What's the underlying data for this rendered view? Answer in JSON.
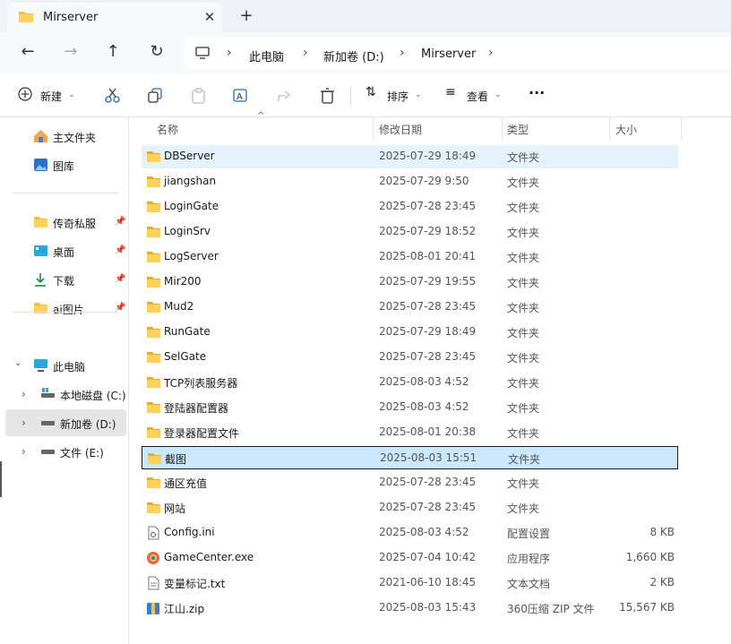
{
  "tab": {
    "title": "Mirserver",
    "close": "✕",
    "new": "+"
  },
  "nav": {
    "back": "←",
    "forward": "→",
    "up": "↑",
    "refresh": "↻"
  },
  "breadcrumb": [
    "此电脑",
    "新加卷 (D:)",
    "Mirserver"
  ],
  "toolbar": {
    "new_label": "新建",
    "sort_label": "排序",
    "view_label": "查看",
    "more": "···"
  },
  "sidebar": {
    "home": "主文件夹",
    "gallery": "图库",
    "pinned": [
      "传奇私服",
      "桌面",
      "下载",
      "ai图片"
    ],
    "this_pc": "此电脑",
    "drives": [
      "本地磁盘 (C:)",
      "新加卷 (D:)",
      "文件 (E:)"
    ]
  },
  "columns": {
    "name": "名称",
    "date": "修改日期",
    "type": "类型",
    "size": "大小"
  },
  "files": [
    {
      "name": "DBServer",
      "date": "2025-07-29 18:49",
      "type": "文件夹",
      "size": "",
      "icon": "folder-icon"
    },
    {
      "name": "jiangshan",
      "date": "2025-07-29 9:50",
      "type": "文件夹",
      "size": "",
      "icon": "folder-icon"
    },
    {
      "name": "LoginGate",
      "date": "2025-07-28 23:45",
      "type": "文件夹",
      "size": "",
      "icon": "folder-icon"
    },
    {
      "name": "LoginSrv",
      "date": "2025-07-29 18:52",
      "type": "文件夹",
      "size": "",
      "icon": "folder-icon"
    },
    {
      "name": "LogServer",
      "date": "2025-08-01 20:41",
      "type": "文件夹",
      "size": "",
      "icon": "folder-icon"
    },
    {
      "name": "Mir200",
      "date": "2025-07-29 19:55",
      "type": "文件夹",
      "size": "",
      "icon": "folder-icon"
    },
    {
      "name": "Mud2",
      "date": "2025-07-28 23:45",
      "type": "文件夹",
      "size": "",
      "icon": "folder-icon"
    },
    {
      "name": "RunGate",
      "date": "2025-07-29 18:49",
      "type": "文件夹",
      "size": "",
      "icon": "folder-icon"
    },
    {
      "name": "SelGate",
      "date": "2025-07-28 23:45",
      "type": "文件夹",
      "size": "",
      "icon": "folder-icon"
    },
    {
      "name": "TCP列表服务器",
      "date": "2025-08-03 4:52",
      "type": "文件夹",
      "size": "",
      "icon": "folder-icon"
    },
    {
      "name": "登陆器配置器",
      "date": "2025-08-03 4:52",
      "type": "文件夹",
      "size": "",
      "icon": "folder-icon"
    },
    {
      "name": "登录器配置文件",
      "date": "2025-08-01 20:38",
      "type": "文件夹",
      "size": "",
      "icon": "folder-icon"
    },
    {
      "name": "截图",
      "date": "2025-08-03 15:51",
      "type": "文件夹",
      "size": "",
      "icon": "folder-icon"
    },
    {
      "name": "通区充值",
      "date": "2025-07-28 23:45",
      "type": "文件夹",
      "size": "",
      "icon": "folder-icon"
    },
    {
      "name": "网站",
      "date": "2025-07-28 23:45",
      "type": "文件夹",
      "size": "",
      "icon": "folder-icon"
    },
    {
      "name": "Config.ini",
      "date": "2025-08-03 4:52",
      "type": "配置设置",
      "size": "8 KB",
      "icon": "ini-file-icon"
    },
    {
      "name": "GameCenter.exe",
      "date": "2025-07-04 10:42",
      "type": "应用程序",
      "size": "1,660 KB",
      "icon": "exe-file-icon"
    },
    {
      "name": "变量标记.txt",
      "date": "2021-06-10 18:45",
      "type": "文本文档",
      "size": "2 KB",
      "icon": "txt-file-icon"
    },
    {
      "name": "江山.zip",
      "date": "2025-08-03 15:43",
      "type": "360压缩 ZIP 文件",
      "size": "15,567 KB",
      "icon": "zip-file-icon"
    }
  ],
  "colors": {
    "accent": "#0078d4",
    "folder": "#f4c143",
    "hover": "#e5f1fb",
    "selected": "#cce8ff"
  }
}
